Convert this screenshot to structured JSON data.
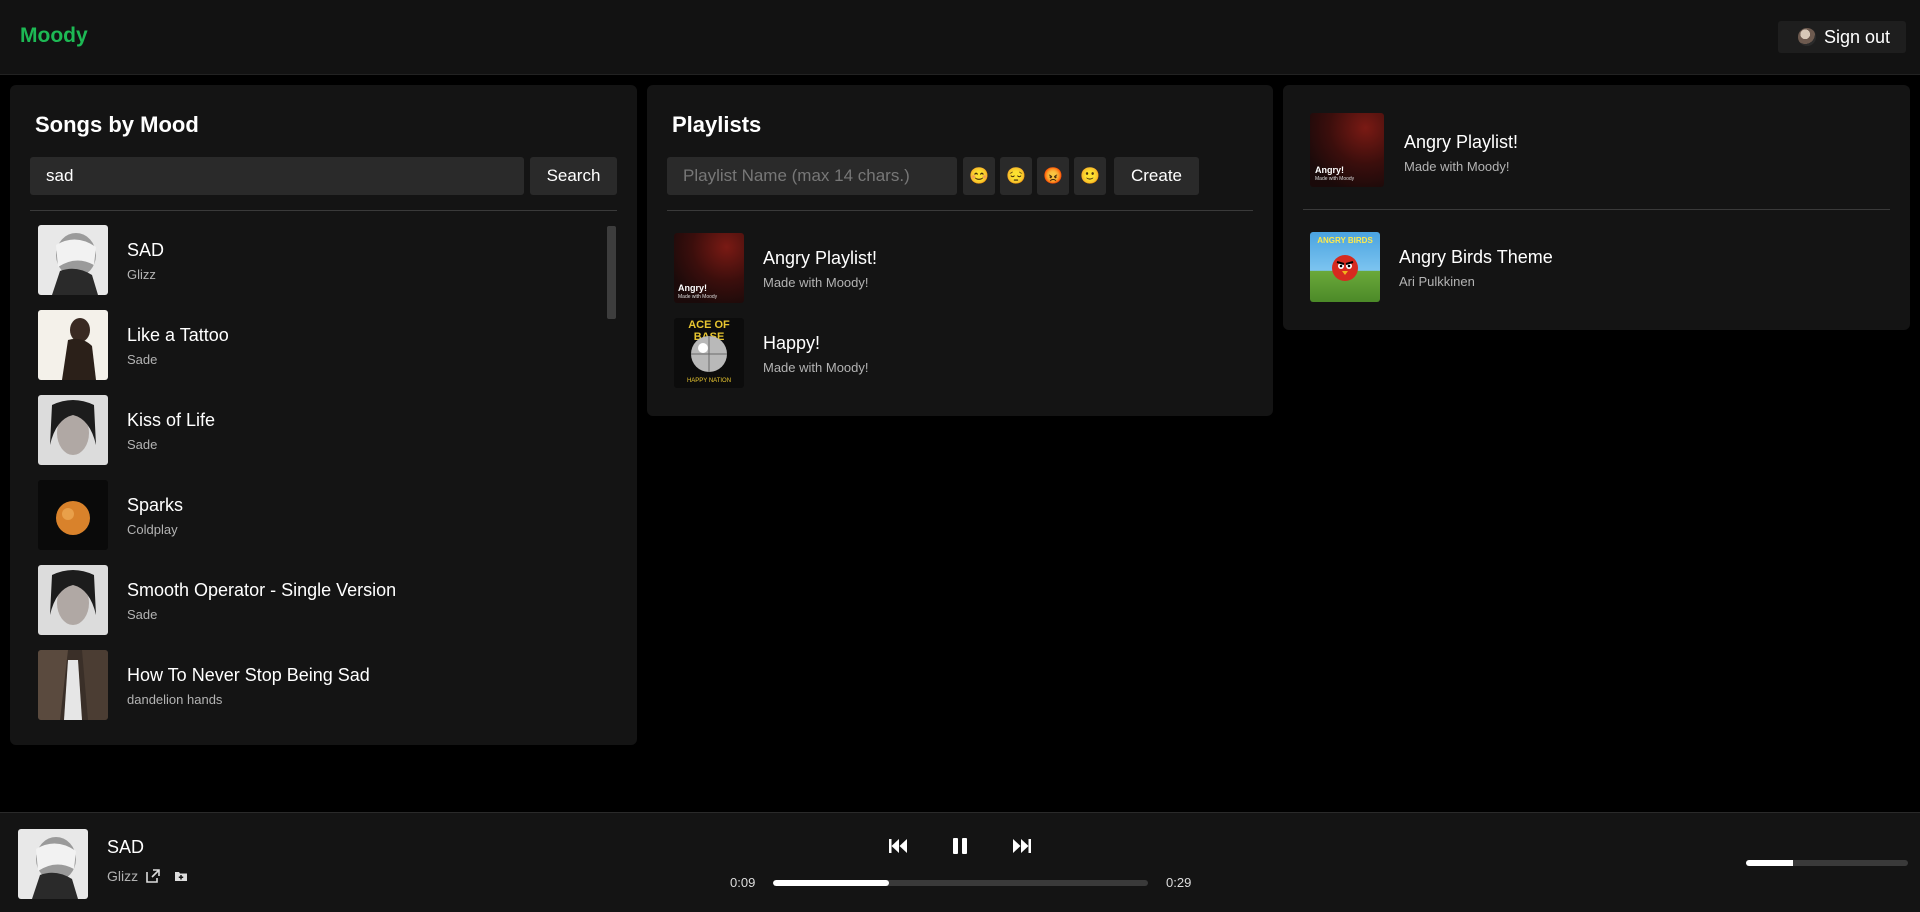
{
  "app": {
    "name": "Moody",
    "accent": "#1db954"
  },
  "header": {
    "signout_label": "Sign out"
  },
  "songs_panel": {
    "title": "Songs by Mood",
    "search_value": "sad",
    "search_label": "Search",
    "tracks": [
      {
        "title": "SAD",
        "artist": "Glizz"
      },
      {
        "title": "Like a Tattoo",
        "artist": "Sade"
      },
      {
        "title": "Kiss of Life",
        "artist": "Sade"
      },
      {
        "title": "Sparks",
        "artist": "Coldplay"
      },
      {
        "title": "Smooth Operator - Single Version",
        "artist": "Sade"
      },
      {
        "title": "How To Never Stop Being Sad",
        "artist": "dandelion hands"
      }
    ]
  },
  "playlists_panel": {
    "title": "Playlists",
    "name_placeholder": "Playlist Name (max 14 chars.)",
    "mood_buttons": [
      "😊",
      "😔",
      "😡",
      "🙂"
    ],
    "create_label": "Create",
    "playlists": [
      {
        "name": "Angry Playlist!",
        "subtitle": "Made with Moody!",
        "cover_text": "Angry!",
        "cover_subtext": "Made with Moody"
      },
      {
        "name": "Happy!",
        "subtitle": "Made with Moody!",
        "cover_text": "ACE OF BASE",
        "cover_subtext": "HAPPY NATION"
      }
    ]
  },
  "detail_panel": {
    "playlist_name": "Angry Playlist!",
    "playlist_subtitle": "Made with Moody!",
    "cover_text": "Angry!",
    "cover_subtext": "Made with Moody",
    "tracks": [
      {
        "title": "Angry Birds Theme",
        "artist": "Ari Pulkkinen",
        "cover_text": "ANGRY BIRDS"
      }
    ]
  },
  "player": {
    "title": "SAD",
    "artist": "Glizz",
    "elapsed": "0:09",
    "duration": "0:29",
    "progress": 0.31,
    "volume": 0.29
  }
}
